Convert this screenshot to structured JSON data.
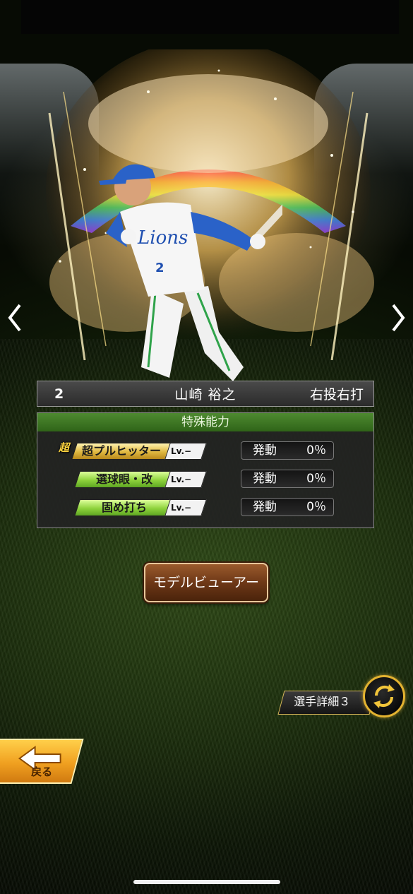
{
  "player": {
    "number": "2",
    "name": "山崎 裕之",
    "handedness": "右投右打",
    "uniform_text": "Lions",
    "uniform_number": "2"
  },
  "abilities": {
    "header": "特殊能力",
    "items": [
      {
        "badge": "超",
        "name": "超プルヒッター",
        "level": "Lv.−",
        "effect_label": "発動",
        "effect_value": "0％",
        "tier": "gold"
      },
      {
        "badge": "",
        "name": "選球眼・改",
        "level": "Lv.−",
        "effect_label": "発動",
        "effect_value": "0％",
        "tier": "green"
      },
      {
        "badge": "",
        "name": "固め打ち",
        "level": "Lv.−",
        "effect_label": "発動",
        "effect_value": "0％",
        "tier": "green"
      }
    ]
  },
  "buttons": {
    "model_viewer": "モデルビューアー",
    "player_detail": "選手詳細３",
    "back": "戻る"
  },
  "icons": {
    "prev": "chevron-left-icon",
    "next": "chevron-right-icon",
    "swap": "swap-arrows-icon",
    "back": "back-arrow-icon"
  },
  "colors": {
    "ability_header": "#2f6418",
    "gold_tag": "#e0b840",
    "green_tag": "#8ed23c",
    "button_brown": "#6e3817",
    "back_orange": "#f0a020"
  }
}
